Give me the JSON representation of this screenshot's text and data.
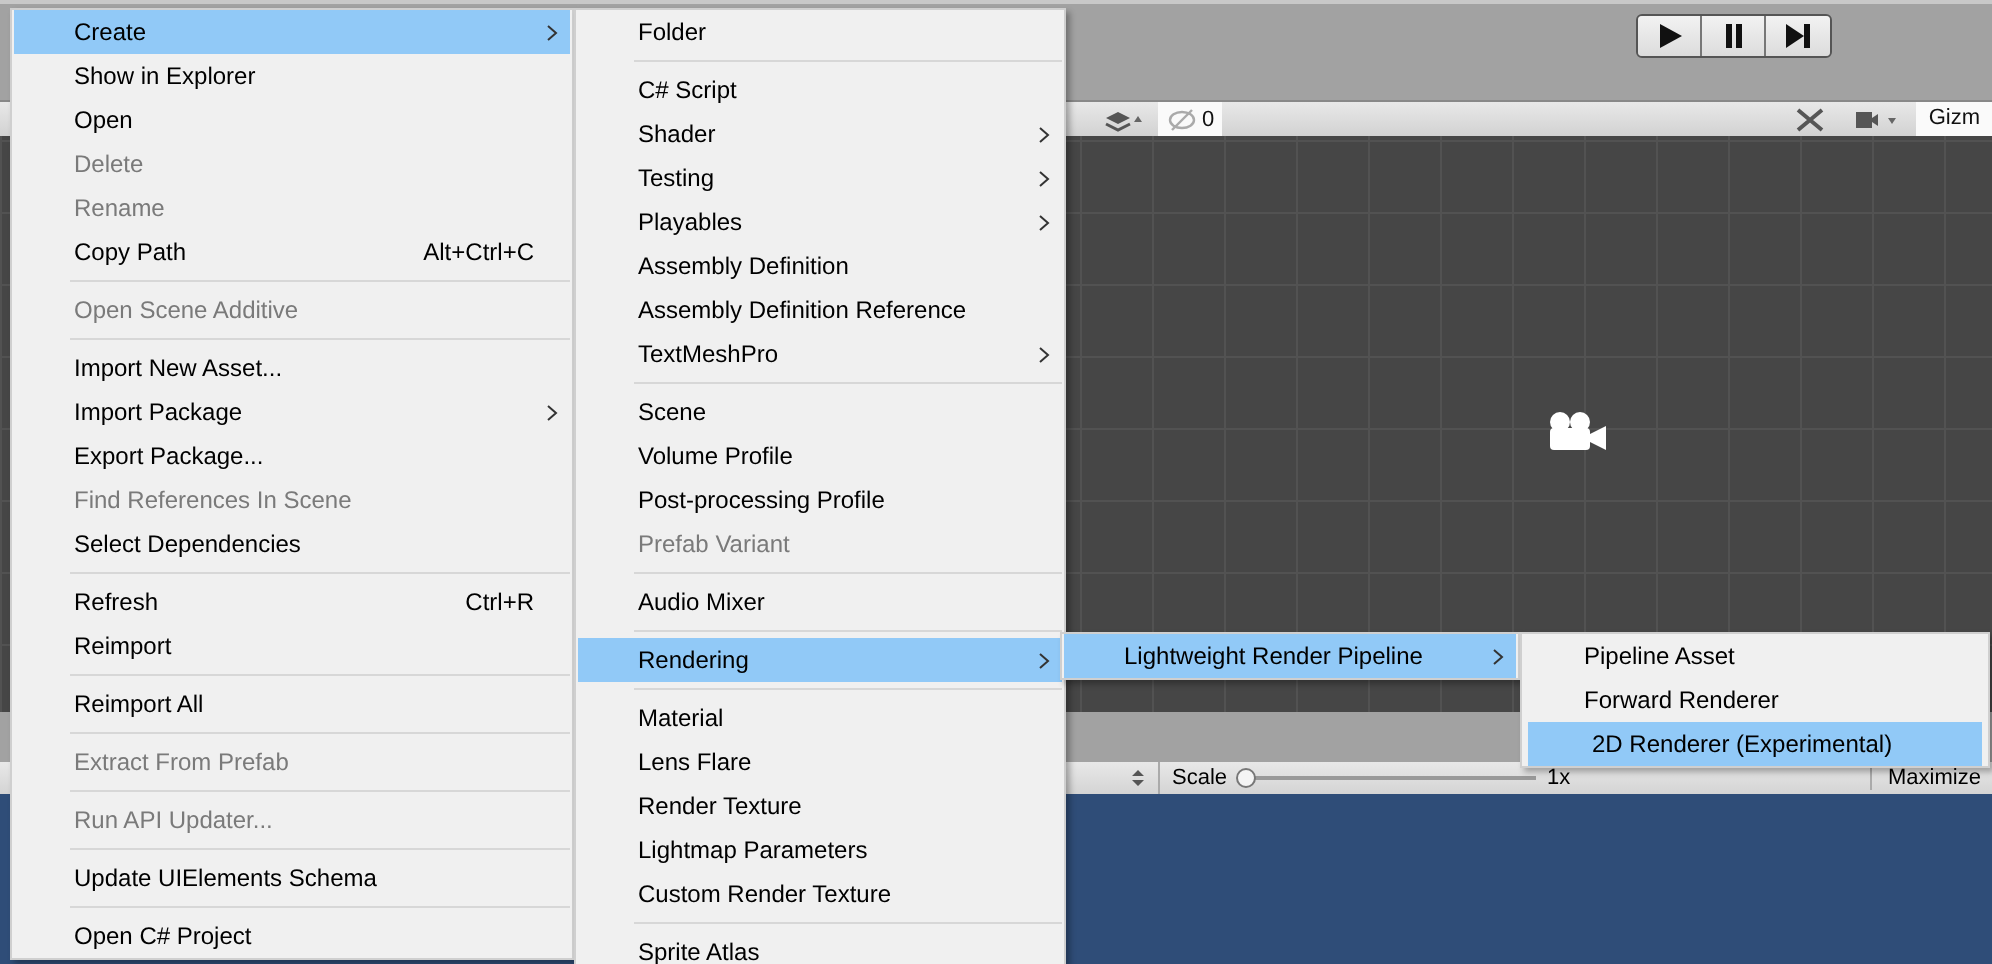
{
  "editor": {
    "play_controls": {
      "play_selected": false,
      "pause_selected": false,
      "step_selected": false
    },
    "scene_toolbar": {
      "hidden_count": "0",
      "gizmos": "Gizm"
    },
    "game_toolbar": {
      "scale_label": "Scale",
      "scale": {
        "level": 0
      },
      "scale_value": "1x",
      "maximize": "Maximize"
    }
  },
  "menus": [
    {
      "items": [
        {
          "kind": "item",
          "label": "Create",
          "submenu": true,
          "selected": true,
          "disabled": false
        },
        {
          "kind": "item",
          "label": "Show in Explorer",
          "selected": false,
          "disabled": false
        },
        {
          "kind": "item",
          "label": "Open",
          "selected": false,
          "disabled": false
        },
        {
          "kind": "item",
          "label": "Delete",
          "selected": false,
          "disabled": true
        },
        {
          "kind": "item",
          "label": "Rename",
          "selected": false,
          "disabled": true
        },
        {
          "kind": "item",
          "label": "Copy Path",
          "shortcut": "Alt+Ctrl+C",
          "selected": false,
          "disabled": false
        },
        {
          "kind": "separator"
        },
        {
          "kind": "item",
          "label": "Open Scene Additive",
          "selected": false,
          "disabled": true
        },
        {
          "kind": "separator"
        },
        {
          "kind": "item",
          "label": "Import New Asset...",
          "selected": false,
          "disabled": false
        },
        {
          "kind": "item",
          "label": "Import Package",
          "submenu": true,
          "selected": false,
          "disabled": false
        },
        {
          "kind": "item",
          "label": "Export Package...",
          "selected": false,
          "disabled": false
        },
        {
          "kind": "item",
          "label": "Find References In Scene",
          "selected": false,
          "disabled": true
        },
        {
          "kind": "item",
          "label": "Select Dependencies",
          "selected": false,
          "disabled": false
        },
        {
          "kind": "separator"
        },
        {
          "kind": "item",
          "label": "Refresh",
          "shortcut": "Ctrl+R",
          "selected": false,
          "disabled": false
        },
        {
          "kind": "item",
          "label": "Reimport",
          "selected": false,
          "disabled": false
        },
        {
          "kind": "separator"
        },
        {
          "kind": "item",
          "label": "Reimport All",
          "selected": false,
          "disabled": false
        },
        {
          "kind": "separator"
        },
        {
          "kind": "item",
          "label": "Extract From Prefab",
          "selected": false,
          "disabled": true
        },
        {
          "kind": "separator"
        },
        {
          "kind": "item",
          "label": "Run API Updater...",
          "selected": false,
          "disabled": true
        },
        {
          "kind": "separator"
        },
        {
          "kind": "item",
          "label": "Update UIElements Schema",
          "selected": false,
          "disabled": false
        },
        {
          "kind": "separator"
        },
        {
          "kind": "item",
          "label": "Open C# Project",
          "selected": false,
          "disabled": false
        }
      ]
    },
    {
      "items": [
        {
          "kind": "item",
          "label": "Folder",
          "selected": false,
          "disabled": false
        },
        {
          "kind": "separator"
        },
        {
          "kind": "item",
          "label": "C# Script",
          "selected": false,
          "disabled": false
        },
        {
          "kind": "item",
          "label": "Shader",
          "submenu": true,
          "selected": false,
          "disabled": false
        },
        {
          "kind": "item",
          "label": "Testing",
          "submenu": true,
          "selected": false,
          "disabled": false
        },
        {
          "kind": "item",
          "label": "Playables",
          "submenu": true,
          "selected": false,
          "disabled": false
        },
        {
          "kind": "item",
          "label": "Assembly Definition",
          "selected": false,
          "disabled": false
        },
        {
          "kind": "item",
          "label": "Assembly Definition Reference",
          "selected": false,
          "disabled": false
        },
        {
          "kind": "item",
          "label": "TextMeshPro",
          "submenu": true,
          "selected": false,
          "disabled": false
        },
        {
          "kind": "separator"
        },
        {
          "kind": "item",
          "label": "Scene",
          "selected": false,
          "disabled": false
        },
        {
          "kind": "item",
          "label": "Volume Profile",
          "selected": false,
          "disabled": false
        },
        {
          "kind": "item",
          "label": "Post-processing Profile",
          "selected": false,
          "disabled": false
        },
        {
          "kind": "item",
          "label": "Prefab Variant",
          "selected": false,
          "disabled": true
        },
        {
          "kind": "separator"
        },
        {
          "kind": "item",
          "label": "Audio Mixer",
          "selected": false,
          "disabled": false
        },
        {
          "kind": "separator"
        },
        {
          "kind": "item",
          "label": "Rendering",
          "submenu": true,
          "selected": true,
          "disabled": false
        },
        {
          "kind": "separator"
        },
        {
          "kind": "item",
          "label": "Material",
          "selected": false,
          "disabled": false
        },
        {
          "kind": "item",
          "label": "Lens Flare",
          "selected": false,
          "disabled": false
        },
        {
          "kind": "item",
          "label": "Render Texture",
          "selected": false,
          "disabled": false
        },
        {
          "kind": "item",
          "label": "Lightmap Parameters",
          "selected": false,
          "disabled": false
        },
        {
          "kind": "item",
          "label": "Custom Render Texture",
          "selected": false,
          "disabled": false
        },
        {
          "kind": "separator"
        },
        {
          "kind": "item",
          "label": "Sprite Atlas",
          "selected": false,
          "disabled": false
        }
      ]
    },
    {
      "items": [
        {
          "kind": "item",
          "label": "Lightweight Render Pipeline",
          "submenu": true,
          "selected": true,
          "disabled": false
        }
      ]
    },
    {
      "items": [
        {
          "kind": "item",
          "label": "Pipeline Asset",
          "selected": false,
          "disabled": false
        },
        {
          "kind": "item",
          "label": "Forward Renderer",
          "selected": false,
          "disabled": false
        },
        {
          "kind": "item",
          "label": "2D Renderer (Experimental)",
          "selected": true,
          "disabled": false
        }
      ]
    }
  ]
}
